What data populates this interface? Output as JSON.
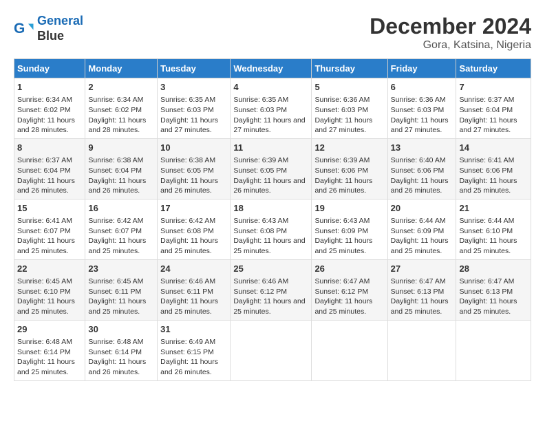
{
  "header": {
    "logo_line1": "General",
    "logo_line2": "Blue",
    "title": "December 2024",
    "subtitle": "Gora, Katsina, Nigeria"
  },
  "days": [
    "Sunday",
    "Monday",
    "Tuesday",
    "Wednesday",
    "Thursday",
    "Friday",
    "Saturday"
  ],
  "weeks": [
    [
      {
        "day": "1",
        "sunrise": "6:34 AM",
        "sunset": "6:02 PM",
        "daylight": "11 hours and 28 minutes."
      },
      {
        "day": "2",
        "sunrise": "6:34 AM",
        "sunset": "6:02 PM",
        "daylight": "11 hours and 28 minutes."
      },
      {
        "day": "3",
        "sunrise": "6:35 AM",
        "sunset": "6:03 PM",
        "daylight": "11 hours and 27 minutes."
      },
      {
        "day": "4",
        "sunrise": "6:35 AM",
        "sunset": "6:03 PM",
        "daylight": "11 hours and 27 minutes."
      },
      {
        "day": "5",
        "sunrise": "6:36 AM",
        "sunset": "6:03 PM",
        "daylight": "11 hours and 27 minutes."
      },
      {
        "day": "6",
        "sunrise": "6:36 AM",
        "sunset": "6:03 PM",
        "daylight": "11 hours and 27 minutes."
      },
      {
        "day": "7",
        "sunrise": "6:37 AM",
        "sunset": "6:04 PM",
        "daylight": "11 hours and 27 minutes."
      }
    ],
    [
      {
        "day": "8",
        "sunrise": "6:37 AM",
        "sunset": "6:04 PM",
        "daylight": "11 hours and 26 minutes."
      },
      {
        "day": "9",
        "sunrise": "6:38 AM",
        "sunset": "6:04 PM",
        "daylight": "11 hours and 26 minutes."
      },
      {
        "day": "10",
        "sunrise": "6:38 AM",
        "sunset": "6:05 PM",
        "daylight": "11 hours and 26 minutes."
      },
      {
        "day": "11",
        "sunrise": "6:39 AM",
        "sunset": "6:05 PM",
        "daylight": "11 hours and 26 minutes."
      },
      {
        "day": "12",
        "sunrise": "6:39 AM",
        "sunset": "6:06 PM",
        "daylight": "11 hours and 26 minutes."
      },
      {
        "day": "13",
        "sunrise": "6:40 AM",
        "sunset": "6:06 PM",
        "daylight": "11 hours and 26 minutes."
      },
      {
        "day": "14",
        "sunrise": "6:41 AM",
        "sunset": "6:06 PM",
        "daylight": "11 hours and 25 minutes."
      }
    ],
    [
      {
        "day": "15",
        "sunrise": "6:41 AM",
        "sunset": "6:07 PM",
        "daylight": "11 hours and 25 minutes."
      },
      {
        "day": "16",
        "sunrise": "6:42 AM",
        "sunset": "6:07 PM",
        "daylight": "11 hours and 25 minutes."
      },
      {
        "day": "17",
        "sunrise": "6:42 AM",
        "sunset": "6:08 PM",
        "daylight": "11 hours and 25 minutes."
      },
      {
        "day": "18",
        "sunrise": "6:43 AM",
        "sunset": "6:08 PM",
        "daylight": "11 hours and 25 minutes."
      },
      {
        "day": "19",
        "sunrise": "6:43 AM",
        "sunset": "6:09 PM",
        "daylight": "11 hours and 25 minutes."
      },
      {
        "day": "20",
        "sunrise": "6:44 AM",
        "sunset": "6:09 PM",
        "daylight": "11 hours and 25 minutes."
      },
      {
        "day": "21",
        "sunrise": "6:44 AM",
        "sunset": "6:10 PM",
        "daylight": "11 hours and 25 minutes."
      }
    ],
    [
      {
        "day": "22",
        "sunrise": "6:45 AM",
        "sunset": "6:10 PM",
        "daylight": "11 hours and 25 minutes."
      },
      {
        "day": "23",
        "sunrise": "6:45 AM",
        "sunset": "6:11 PM",
        "daylight": "11 hours and 25 minutes."
      },
      {
        "day": "24",
        "sunrise": "6:46 AM",
        "sunset": "6:11 PM",
        "daylight": "11 hours and 25 minutes."
      },
      {
        "day": "25",
        "sunrise": "6:46 AM",
        "sunset": "6:12 PM",
        "daylight": "11 hours and 25 minutes."
      },
      {
        "day": "26",
        "sunrise": "6:47 AM",
        "sunset": "6:12 PM",
        "daylight": "11 hours and 25 minutes."
      },
      {
        "day": "27",
        "sunrise": "6:47 AM",
        "sunset": "6:13 PM",
        "daylight": "11 hours and 25 minutes."
      },
      {
        "day": "28",
        "sunrise": "6:47 AM",
        "sunset": "6:13 PM",
        "daylight": "11 hours and 25 minutes."
      }
    ],
    [
      {
        "day": "29",
        "sunrise": "6:48 AM",
        "sunset": "6:14 PM",
        "daylight": "11 hours and 25 minutes."
      },
      {
        "day": "30",
        "sunrise": "6:48 AM",
        "sunset": "6:14 PM",
        "daylight": "11 hours and 26 minutes."
      },
      {
        "day": "31",
        "sunrise": "6:49 AM",
        "sunset": "6:15 PM",
        "daylight": "11 hours and 26 minutes."
      },
      null,
      null,
      null,
      null
    ]
  ]
}
